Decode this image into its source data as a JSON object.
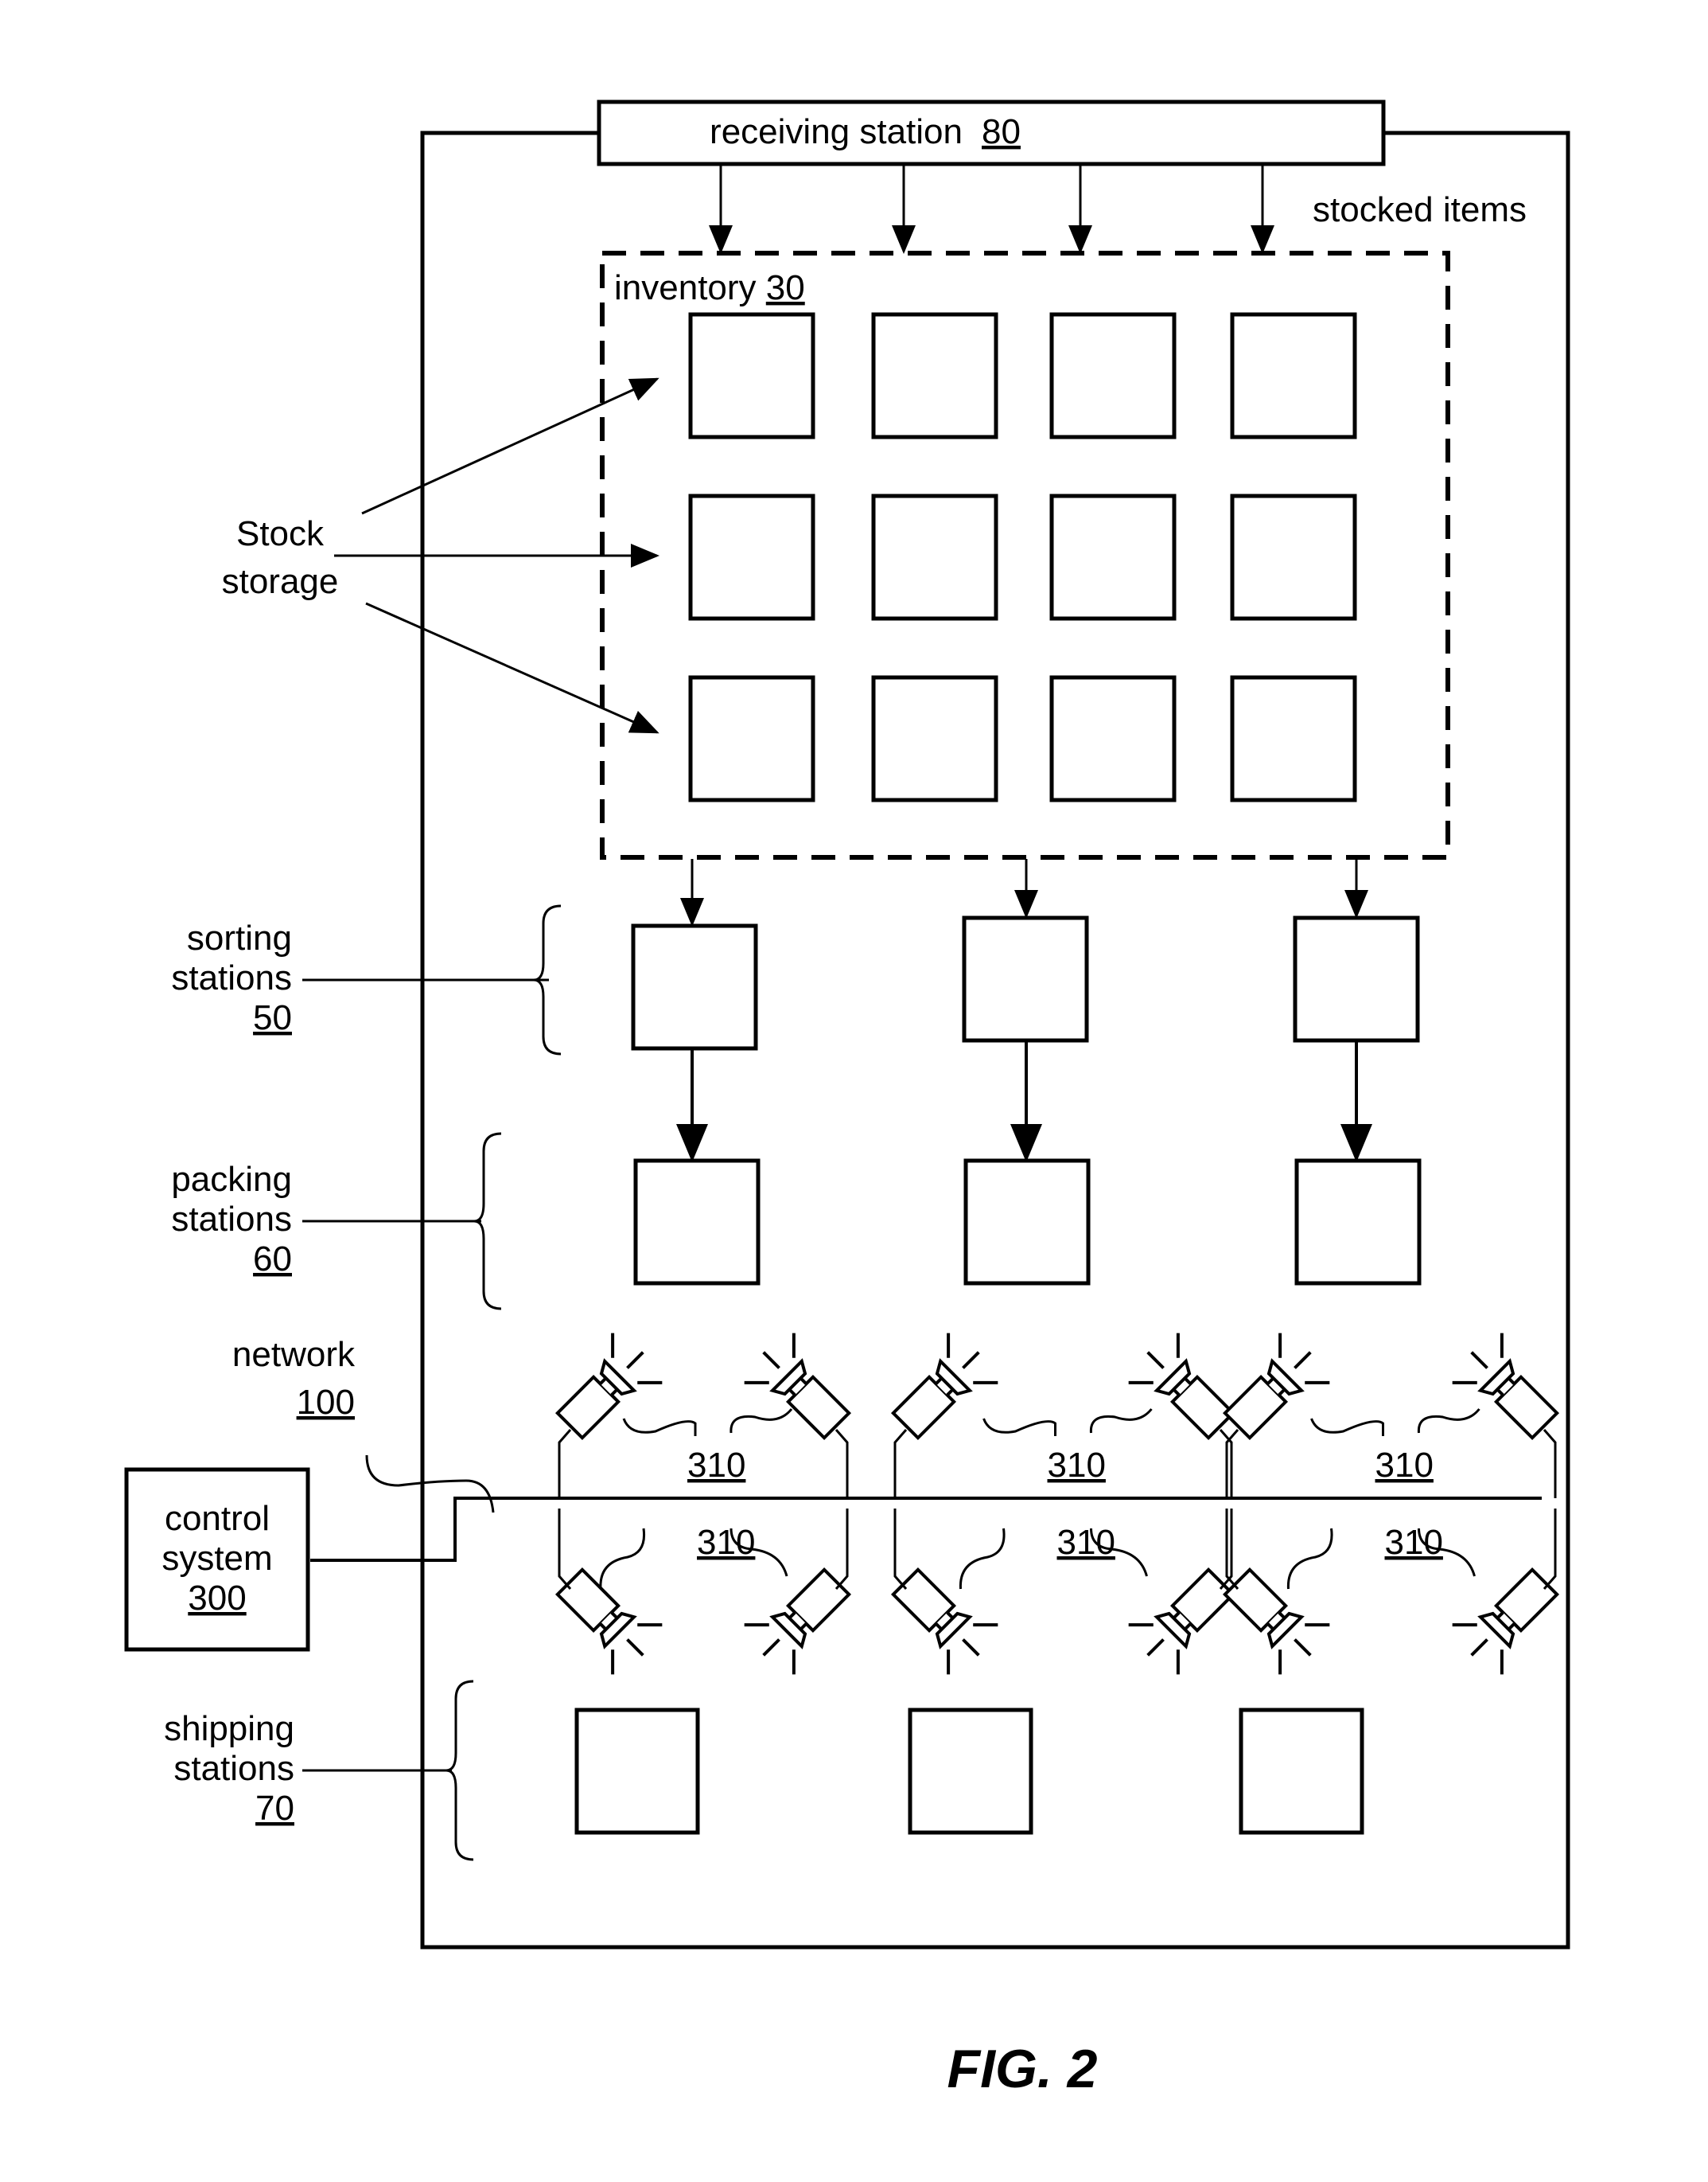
{
  "figure": {
    "caption": "FIG. 2",
    "receiving_station": {
      "label": "receiving station",
      "ref": "80"
    },
    "stocked_items_label": "stocked items",
    "inventory": {
      "label": "inventory",
      "ref": "30"
    },
    "stock_storage_label": [
      "Stock",
      "storage"
    ],
    "sorting_stations": {
      "lines": [
        "sorting",
        "stations"
      ],
      "ref": "50"
    },
    "packing_stations": {
      "lines": [
        "packing",
        "stations"
      ],
      "ref": "60"
    },
    "network": {
      "label": "network",
      "ref": "100"
    },
    "control_system": {
      "lines": [
        "control",
        "system"
      ],
      "ref": "300"
    },
    "camera_ref": "310",
    "shipping_stations": {
      "lines": [
        "shipping",
        "stations"
      ],
      "ref": "70"
    }
  }
}
